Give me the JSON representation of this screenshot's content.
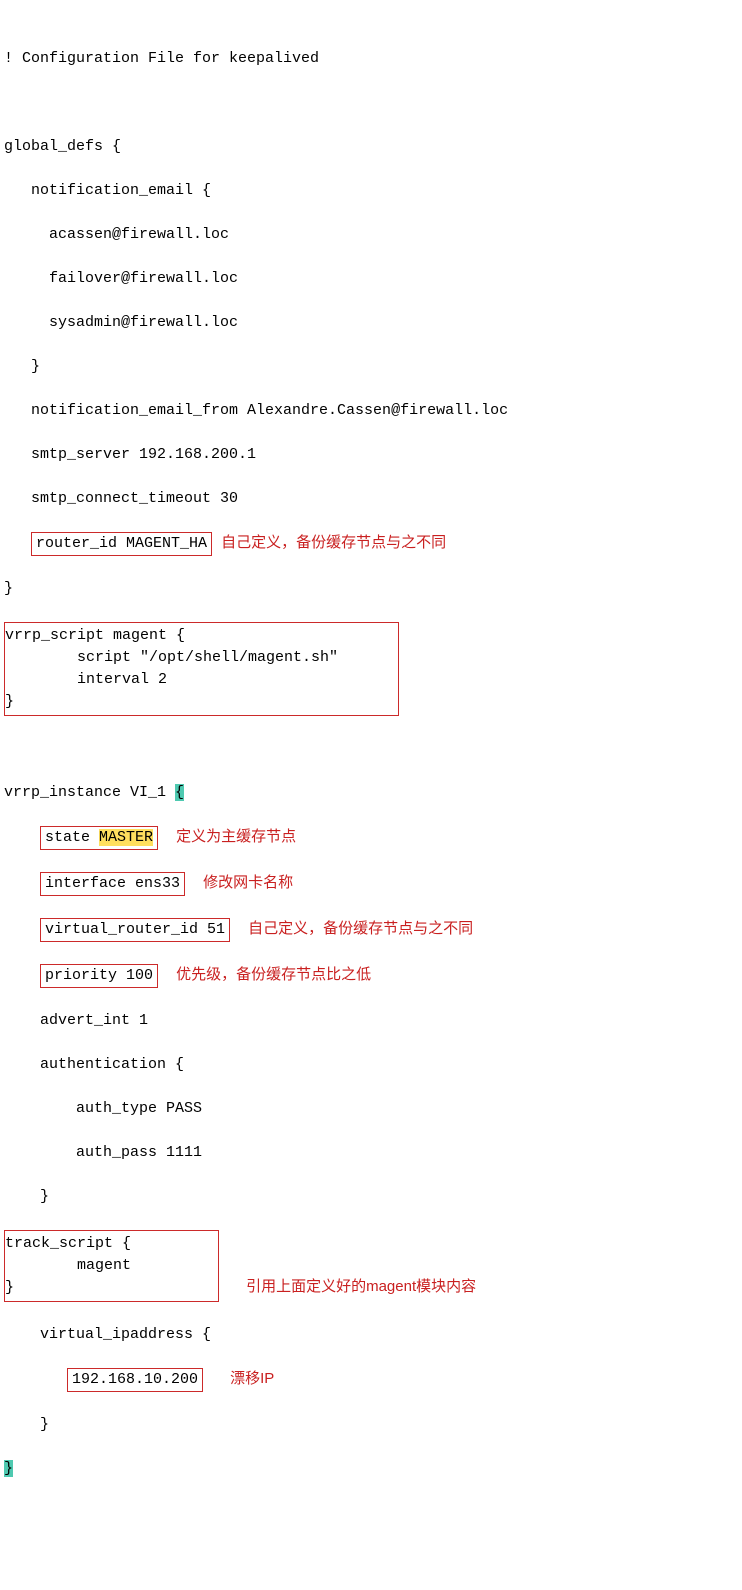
{
  "lines": {
    "0": "! Configuration File for keepalived",
    "1": "global_defs {",
    "2": "   notification_email {",
    "3": "     acassen@firewall.loc",
    "4": "     failover@firewall.loc",
    "5": "     sysadmin@firewall.loc",
    "6": "   }",
    "7": "   notification_email_from Alexandre.Cassen@firewall.loc",
    "8": "   smtp_server 192.168.200.1",
    "9": "   smtp_connect_timeout 30",
    "10": "}",
    "11": "vrrp_instance VI_1 ",
    "12": "    advert_int 1",
    "13": "    authentication {",
    "14": "        auth_type PASS",
    "15": "        auth_pass 1111",
    "16": "    }",
    "17": "    virtual_ipaddress {",
    "18": "    }"
  },
  "boxed": {
    "router_id": "router_id MAGENT_HA",
    "vrrp_script": {
      "0": "vrrp_script magent {",
      "1": "        script \"/opt/shell/magent.sh\"",
      "2": "        interval 2",
      "3": "}"
    },
    "state_prefix": "state ",
    "interface": "interface ens33",
    "virtual_router_id": "virtual_router_id 51",
    "priority": "priority 100",
    "track_script": {
      "0": "track_script {",
      "1": "        magent",
      "2": "}"
    },
    "vip": "192.168.10.200"
  },
  "highlight": {
    "master": "MASTER",
    "brace_open": "{",
    "brace_close": "}"
  },
  "notes": {
    "router_id": "自己定义，备份缓存节点与之不同",
    "state": "定义为主缓存节点",
    "interface": "修改网卡名称",
    "virtual_router_id": "自己定义，备份缓存节点与之不同",
    "priority": "优先级，备份缓存节点比之低",
    "track_script": "引用上面定义好的magent模块内容",
    "vip": "漂移IP"
  }
}
